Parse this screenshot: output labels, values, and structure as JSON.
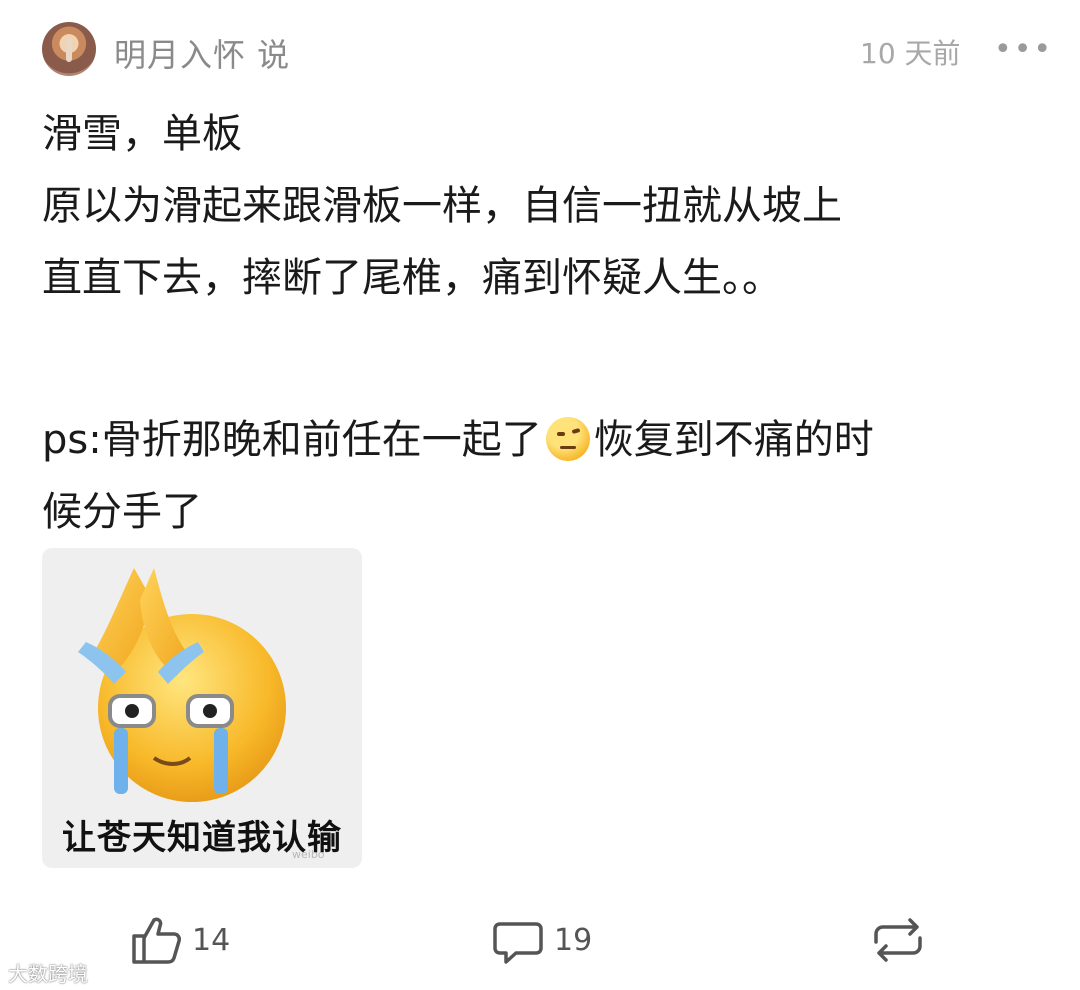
{
  "post": {
    "author_suffix": "明月入怀  说",
    "time": "10 天前",
    "more_label": "•••",
    "lines": [
      "滑雪，单板",
      "原以为滑起来跟滑板一样，自信一扭就从坡上",
      "直直下去，摔断了尾椎，痛到怀疑人生。。"
    ],
    "ps_before_emoji": "ps:骨折那晚和前任在一起了",
    "ps_after_emoji": "恢复到不痛的时",
    "ps_line2": "候分手了",
    "emoji_inline": "raised-eyebrow-emoji-icon"
  },
  "sticker": {
    "caption": "让苍天知道我认输",
    "small_mark": "weibo"
  },
  "actions": {
    "like_count": "14",
    "comment_count": "19"
  },
  "watermark": "大数跨境",
  "colors": {
    "text": "#1a1a1a",
    "muted": "#8a8a8a",
    "icon": "#555555",
    "sticker_bg": "#efefef"
  }
}
